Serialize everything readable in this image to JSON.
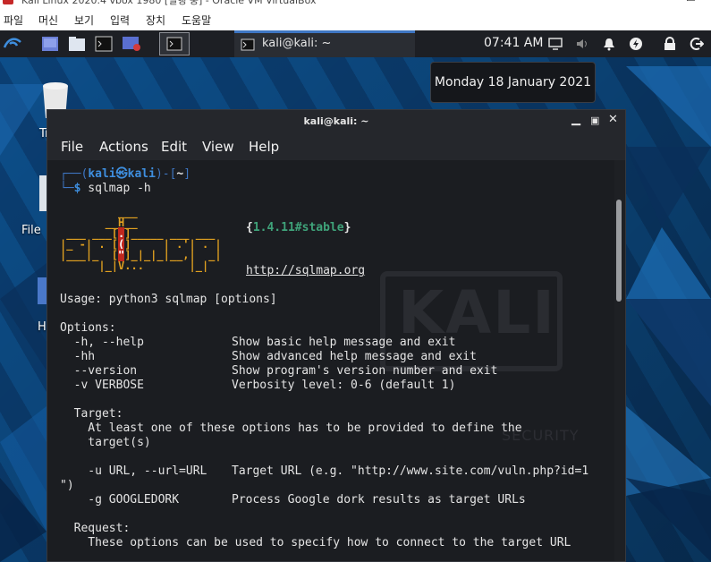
{
  "host": {
    "title": "Kali Linux 2020.4 vbox 1980 [실행 중] - Oracle VM VirtualBox",
    "menu": [
      "파일",
      "머신",
      "보기",
      "입력",
      "장치",
      "도움말"
    ]
  },
  "panel": {
    "task_label": "kali@kali: ~",
    "clock": "07:41 AM"
  },
  "tooltip": {
    "date": "Monday 18 January 2021"
  },
  "desktop": {
    "icons": [
      "Trash",
      "File",
      "H"
    ]
  },
  "terminal": {
    "title": "kali@kali: ~",
    "menu": [
      "File",
      "Actions",
      "Edit",
      "View",
      "Help"
    ],
    "prompt": {
      "frame_top": "┌──(",
      "user": "kali㉿kali",
      "frame_mid": ")-[",
      "path": "~",
      "frame_end": "]",
      "frame_bottom": "└─",
      "dollar": "$",
      "command": " sqlmap -h"
    },
    "version": "1.4.11#stable",
    "url": "http://sqlmap.org",
    "usage": "Usage: python3 sqlmap [options]",
    "options_header": "Options:",
    "options": [
      {
        "flag": "  -h, --help",
        "desc": "Show basic help message and exit"
      },
      {
        "flag": "  -hh",
        "desc": "Show advanced help message and exit"
      },
      {
        "flag": "  --version",
        "desc": "Show program's version number and exit"
      },
      {
        "flag": "  -v VERBOSE",
        "desc": "Verbosity level: 0-6 (default 1)"
      }
    ],
    "target_header": "  Target:",
    "target_text_1": "    At least one of these options has to be provided to define the",
    "target_text_2": "    target(s)",
    "target_options": [
      {
        "flag": "    -u URL, --url=URL",
        "desc": "Target URL (e.g. \"http://www.site.com/vuln.php?id=1"
      },
      {
        "flag": "\")",
        "desc": ""
      },
      {
        "flag": "    -g GOOGLEDORK",
        "desc": "Process Google dork results as target URLs"
      }
    ],
    "request_header": "  Request:",
    "request_text": "    These options can be used to specify how to connect to the target URL",
    "watermark": "KALI",
    "watermark_sub": "SECURITY"
  },
  "colors": {
    "accent": "#3e76c3",
    "terminal_bg": "#1b1d21",
    "panel_bg": "#1d1f24",
    "banner": "#e0a020",
    "banner_red": "#c0281e"
  }
}
